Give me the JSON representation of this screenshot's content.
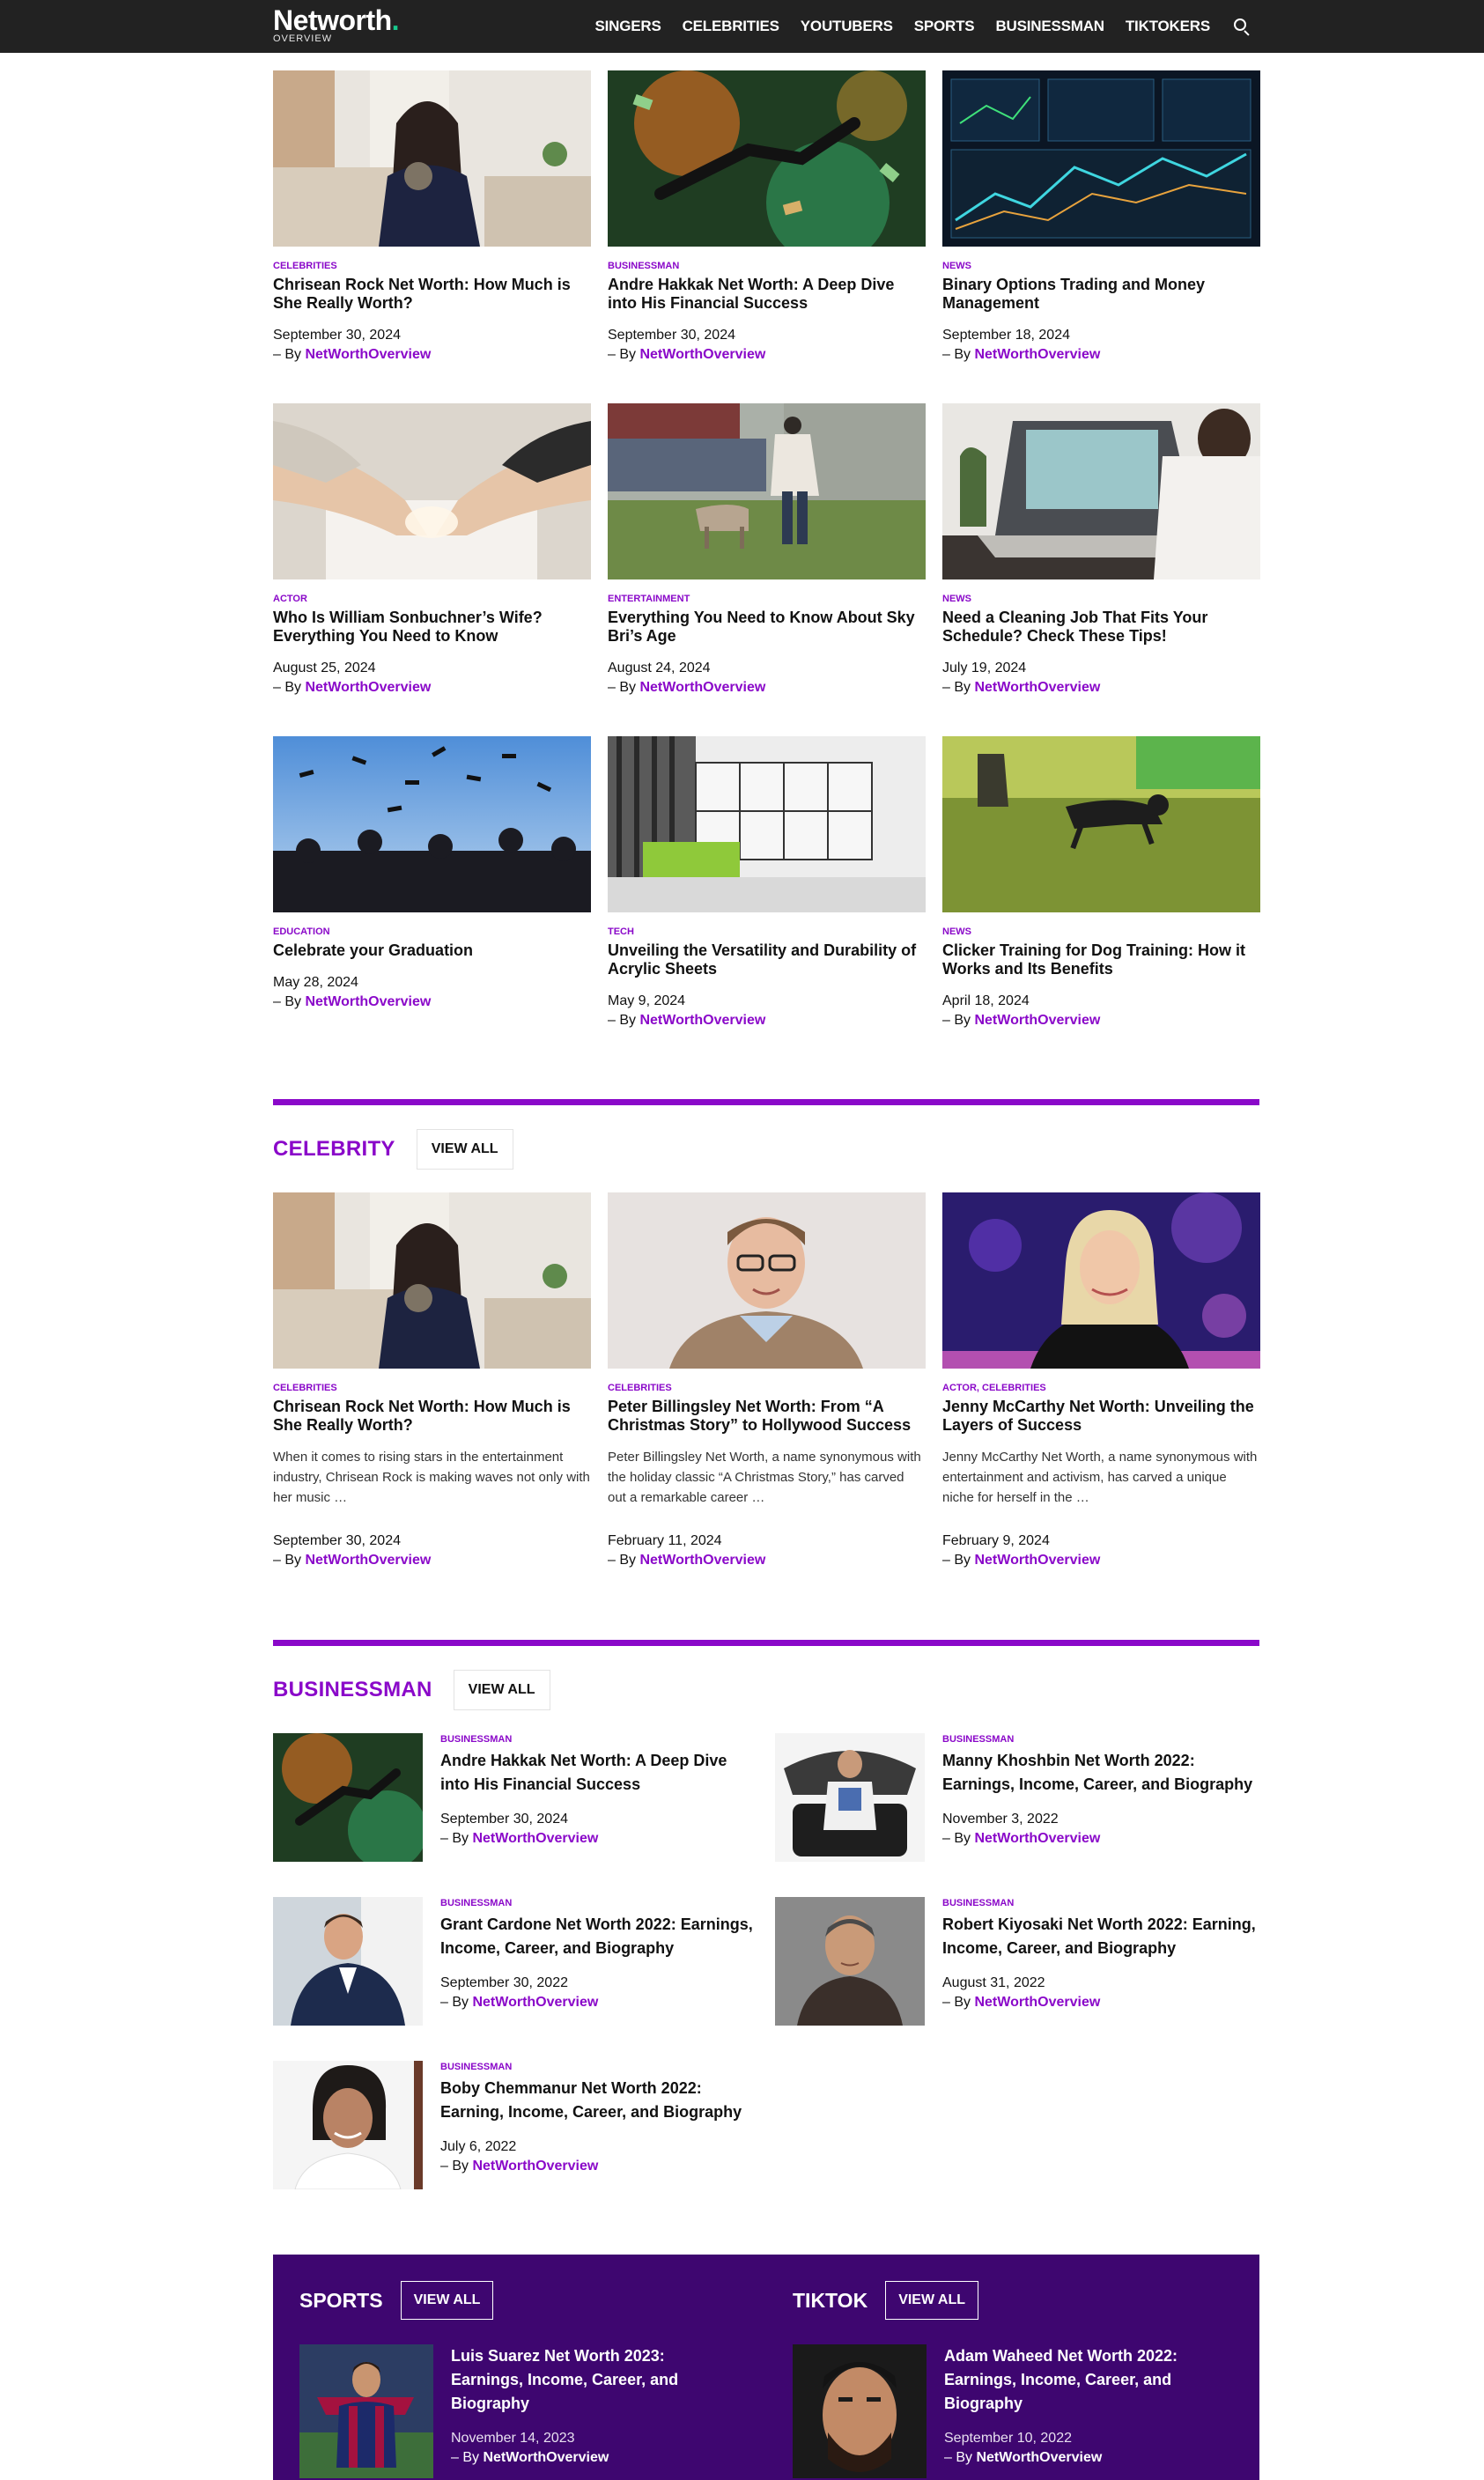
{
  "header": {
    "logo_main": "Networth",
    "logo_sub": "OVERVIEW",
    "nav": [
      "SINGERS",
      "CELEBRITIES",
      "YOUTUBERS",
      "SPORTS",
      "BUSINESSMAN",
      "TIKTOKERS"
    ],
    "search_icon": "search-icon"
  },
  "colors": {
    "accent": "#8a08c9",
    "header_bg": "#222222",
    "purple_box": "#3e0670"
  },
  "byline_prefix": "– By ",
  "author": "NetWorthOverview",
  "grid": [
    {
      "category": "CELEBRITIES",
      "title": "Chrisean Rock Net Worth: How Much is She Really Worth?",
      "date": "September 30, 2024",
      "image": "woman-with-clock-photo"
    },
    {
      "category": "BUSINESSMAN",
      "title": "Andre Hakkak Net Worth: A Deep Dive into His Financial Success",
      "date": "September 30, 2024",
      "image": "money-falling-photo"
    },
    {
      "category": "NEWS",
      "title": "Binary Options Trading and Money Management",
      "date": "September 18, 2024",
      "image": "trading-screens-photo"
    },
    {
      "category": "ACTOR",
      "title": "Who Is William Sonbuchner’s Wife? Everything You Need to Know",
      "date": "August 25, 2024",
      "image": "heart-hands-photo"
    },
    {
      "category": "ENTERTAINMENT",
      "title": "Everything You Need to Know About Sky Bri’s Age",
      "date": "August 24, 2024",
      "image": "man-with-goat-photo"
    },
    {
      "category": "NEWS",
      "title": "Need a Cleaning Job That Fits Your Schedule? Check These Tips!",
      "date": "July 19, 2024",
      "image": "laptop-typing-photo"
    },
    {
      "category": "EDUCATION",
      "title": "Celebrate your Graduation",
      "date": "May 28, 2024",
      "image": "graduation-caps-photo"
    },
    {
      "category": "TECH",
      "title": "Unveiling the Versatility and Durability of Acrylic Sheets",
      "date": "May 9, 2024",
      "image": "office-interior-photo"
    },
    {
      "category": "NEWS",
      "title": "Clicker Training for Dog Training: How it Works and Its Benefits",
      "date": "April 18, 2024",
      "image": "dog-running-photo"
    }
  ],
  "celebrity": {
    "heading": "CELEBRITY",
    "view_all": "VIEW ALL",
    "items": [
      {
        "category": "CELEBRITIES",
        "title": "Chrisean Rock Net Worth: How Much is She Really Worth?",
        "excerpt": "When it comes to rising stars in the entertainment industry, Chrisean Rock is making waves not only with her music …",
        "date": "September 30, 2024"
      },
      {
        "category": "CELEBRITIES",
        "title": "Peter Billingsley Net Worth: From “A Christmas Story” to Hollywood Success",
        "excerpt": "Peter Billingsley Net Worth, a name synonymous with the holiday classic “A Christmas Story,” has carved out a remarkable career …",
        "date": "February 11, 2024"
      },
      {
        "category": "ACTOR, CELEBRITIES",
        "title": "Jenny McCarthy Net Worth: Unveiling the Layers of Success",
        "excerpt": "Jenny McCarthy Net Worth, a name synonymous with entertainment and activism, has carved a unique niche for herself in the …",
        "date": "February 9, 2024"
      }
    ]
  },
  "businessman": {
    "heading": "BUSINESSMAN",
    "view_all": "VIEW ALL",
    "items": [
      {
        "category": "BUSINESSMAN",
        "title": "Andre Hakkak Net Worth: A Deep Dive into His Financial Success",
        "date": "September 30, 2024"
      },
      {
        "category": "BUSINESSMAN",
        "title": "Manny Khoshbin Net Worth 2022: Earnings, Income, Career, and Biography",
        "date": "November 3, 2022"
      },
      {
        "category": "BUSINESSMAN",
        "title": "Grant Cardone  Net Worth 2022: Earnings, Income, Career, and Biography",
        "date": "September 30, 2022"
      },
      {
        "category": "BUSINESSMAN",
        "title": "Robert Kiyosaki Net Worth 2022: Earning, Income, Career, and Biography",
        "date": "August 31, 2022"
      },
      {
        "category": "BUSINESSMAN",
        "title": "Boby Chemmanur Net Worth 2022: Earning, Income, Career, and Biography",
        "date": "July 6, 2022"
      }
    ]
  },
  "sports": {
    "heading": "SPORTS",
    "view_all": "VIEW ALL",
    "item": {
      "title": "Luis Suarez Net Worth 2023: Earnings, Income, Career, and Biography",
      "date": "November 14, 2023"
    }
  },
  "tiktok": {
    "heading": "TIKTOK",
    "view_all": "VIEW ALL",
    "item": {
      "title": "Adam Waheed Net Worth 2022: Earnings, Income, Career, and Biography",
      "date": "September 10, 2022"
    }
  }
}
